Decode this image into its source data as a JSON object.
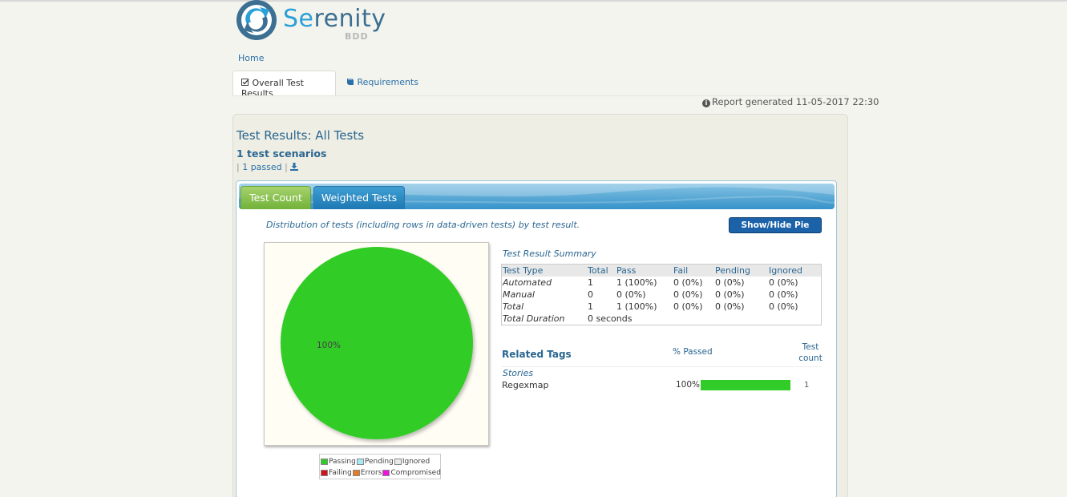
{
  "header": {
    "logo_word_start": "Se",
    "logo_word_rest": "renity",
    "logo_sub": "BDD"
  },
  "nav": {
    "home": "Home",
    "tabs": [
      {
        "label": "Overall Test Results",
        "icon": "check-square-icon",
        "active": true
      },
      {
        "label": "Requirements",
        "icon": "book-icon",
        "active": false
      }
    ]
  },
  "report": {
    "generated": "Report generated 11-05-2017 22:30"
  },
  "results": {
    "title": "Test Results: All Tests",
    "scenarios": "1 test scenarios",
    "passed_link": "1 passed"
  },
  "inner_tabs": [
    {
      "label": "Test Count",
      "active": true
    },
    {
      "label": "Weighted Tests",
      "active": false
    }
  ],
  "distribution_text": "Distribution of tests (including rows in data-driven tests) by test result.",
  "pie_button": "Show/Hide Pie Chart",
  "pie": {
    "slices": [
      {
        "label": "Passing",
        "value": 100,
        "color": "#32cc28"
      }
    ],
    "center_label": "100%"
  },
  "legend": [
    [
      {
        "label": "Passing",
        "color": "#32cc28"
      },
      {
        "label": "Pending",
        "color": "#a6eaf5"
      },
      {
        "label": "Ignored",
        "color": "#e8e8e8"
      }
    ],
    [
      {
        "label": "Failing",
        "color": "#d4111a"
      },
      {
        "label": "Errors",
        "color": "#e67b25"
      },
      {
        "label": "Compromised",
        "color": "#f111e0"
      }
    ]
  ],
  "summary": {
    "title": "Test Result Summary",
    "headers": [
      "Test Type",
      "Total",
      "Pass",
      "Fail",
      "Pending",
      "Ignored"
    ],
    "rows": [
      [
        "Automated",
        "1",
        "1 (100%)",
        "0 (0%)",
        "0 (0%)",
        "0 (0%)"
      ],
      [
        "Manual",
        "0",
        "0 (0%)",
        "0 (0%)",
        "0 (0%)",
        "0 (0%)"
      ],
      [
        "Total",
        "1",
        "1 (100%)",
        "0 (0%)",
        "0 (0%)",
        "0 (0%)"
      ]
    ],
    "duration_label": "Total Duration",
    "duration_value": "0 seconds"
  },
  "related_tags": {
    "title": "Related Tags",
    "passed_header": "% Passed",
    "count_header": "Test count",
    "group": "Stories",
    "items": [
      {
        "name": "Regexmap",
        "percent": "100%",
        "pass_fraction": 1.0,
        "count": "1"
      }
    ]
  }
}
